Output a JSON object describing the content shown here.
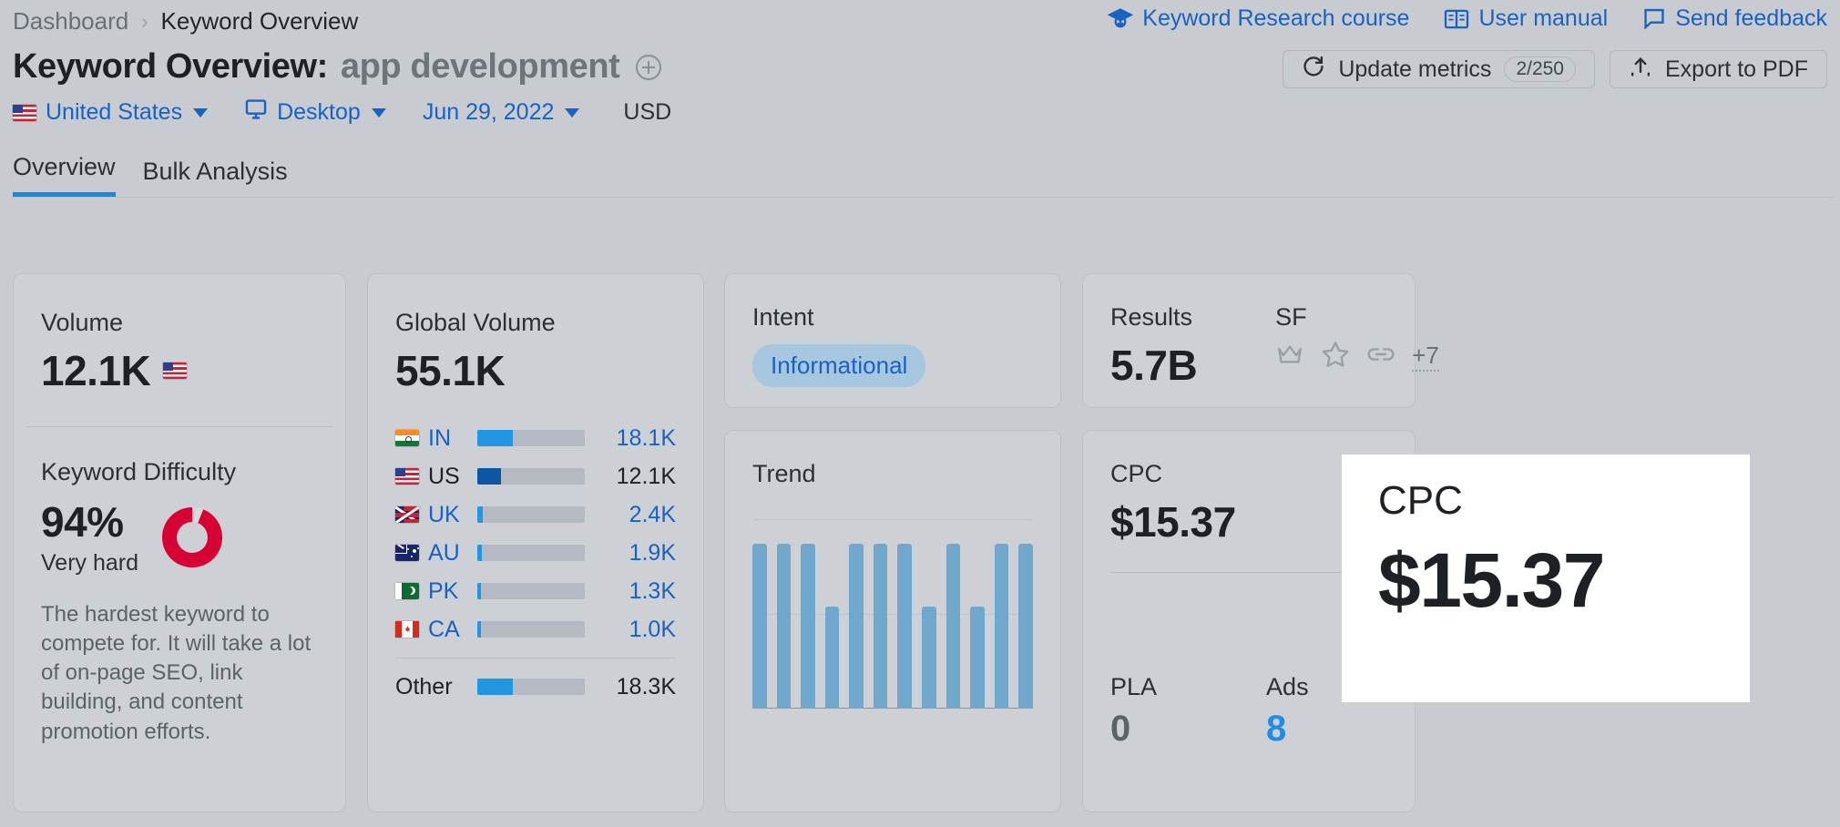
{
  "breadcrumb": {
    "parent": "Dashboard",
    "separator": "›",
    "current": "Keyword Overview"
  },
  "top_links": [
    {
      "label": "Keyword Research course",
      "icon": "graduation-cap-icon"
    },
    {
      "label": "User manual",
      "icon": "book-icon"
    },
    {
      "label": "Send feedback",
      "icon": "speech-bubble-icon"
    }
  ],
  "title": {
    "prefix": "Keyword Overview:",
    "keyword": "app development",
    "add_icon": "plus-circle-icon"
  },
  "actions": {
    "update_metrics_label": "Update metrics",
    "update_metrics_count": "2/250",
    "export_label": "Export to PDF",
    "refresh_icon": "refresh-icon",
    "export_icon": "upload-icon"
  },
  "filters": {
    "country": "United States",
    "country_flag": "us-flag-icon",
    "device": "Desktop",
    "device_icon": "monitor-icon",
    "date": "Jun 29, 2022",
    "currency": "USD"
  },
  "tabs": [
    {
      "label": "Overview",
      "active": true
    },
    {
      "label": "Bulk Analysis",
      "active": false
    }
  ],
  "cards": {
    "volume": {
      "label": "Volume",
      "value": "12.1K",
      "flag": "us-flag-icon",
      "kd_label": "Keyword Difficulty",
      "kd_percent": "94%",
      "kd_word": "Very hard",
      "kd_description": "The hardest keyword to compete for. It will take a lot of on-page SEO, link building, and content promotion efforts.",
      "kd_color": "#d80032",
      "kd_value": 94
    },
    "global_volume": {
      "label": "Global Volume",
      "value": "55.1K",
      "rows": [
        {
          "code": "IN",
          "flag": "in-flag-icon",
          "value": "18.1K",
          "pct": 33,
          "selected": false,
          "bar_color": "#2196e3"
        },
        {
          "code": "US",
          "flag": "us-flag-icon",
          "value": "12.1K",
          "pct": 22,
          "selected": true,
          "bar_color": "#0b57a4"
        },
        {
          "code": "UK",
          "flag": "uk-flag-icon",
          "value": "2.4K",
          "pct": 5,
          "selected": false,
          "bar_color": "#2196e3"
        },
        {
          "code": "AU",
          "flag": "au-flag-icon",
          "value": "1.9K",
          "pct": 4,
          "selected": false,
          "bar_color": "#2196e3"
        },
        {
          "code": "PK",
          "flag": "pk-flag-icon",
          "value": "1.3K",
          "pct": 3,
          "selected": false,
          "bar_color": "#2196e3"
        },
        {
          "code": "CA",
          "flag": "ca-flag-icon",
          "value": "1.0K",
          "pct": 3,
          "selected": false,
          "bar_color": "#2196e3"
        }
      ],
      "other": {
        "code": "Other",
        "value": "18.3K",
        "pct": 33
      }
    },
    "intent": {
      "label": "Intent",
      "chip": "Informational"
    },
    "trend": {
      "label": "Trend",
      "chart_data": {
        "type": "bar",
        "title": "Trend",
        "categories": [
          "1",
          "2",
          "3",
          "4",
          "5",
          "6",
          "7",
          "8",
          "9",
          "10",
          "11",
          "12"
        ],
        "values": [
          100,
          100,
          100,
          62,
          100,
          100,
          100,
          62,
          100,
          62,
          100,
          100
        ],
        "ylim": [
          0,
          115
        ],
        "grid": true,
        "xlabel": "",
        "ylabel": "",
        "bar_color": "#6fa8cc"
      }
    },
    "results": {
      "label": "Results",
      "value": "5.7B",
      "sf_label": "SF",
      "sf_icons": [
        "crown-icon",
        "star-icon",
        "link-icon"
      ],
      "sf_more": "+7"
    },
    "cpc": {
      "label": "CPC",
      "value": "$15.37",
      "pla_label": "PLA",
      "pla_value": "0",
      "ads_label": "Ads",
      "ads_value": "8"
    }
  },
  "overlay": {
    "label": "CPC",
    "value": "$15.37"
  },
  "colors": {
    "link_blue": "#1862c6",
    "accent_blue": "#0b8ce8",
    "bar_blue": "#2196e3",
    "bar_dark_blue": "#0b57a4",
    "trend_bar": "#6fa8cc",
    "kd_red": "#d80032",
    "page_bg": "#c8cbd0",
    "card_bg": "#cdd0d4"
  }
}
